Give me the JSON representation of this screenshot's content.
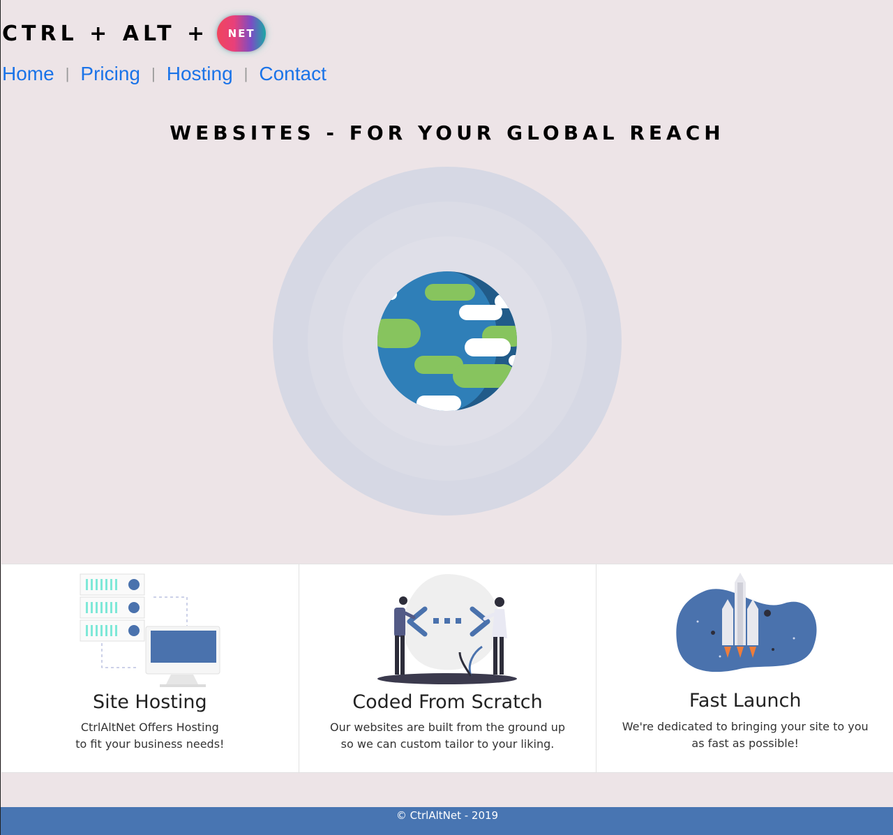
{
  "brand": {
    "text": "CTRL + ALT +",
    "badge": "NET"
  },
  "nav": {
    "items": [
      {
        "label": "Home"
      },
      {
        "label": "Pricing"
      },
      {
        "label": "Hosting"
      },
      {
        "label": "Contact"
      }
    ],
    "separator": "|"
  },
  "hero": {
    "title": "WEBSITES - FOR YOUR GLOBAL REACH",
    "illustration": "globe-icon"
  },
  "features": [
    {
      "icon": "server-monitor-icon",
      "title": "Site Hosting",
      "line1": "CtrlAltNet Offers Hosting",
      "line2": "to fit your business needs!"
    },
    {
      "icon": "code-collaboration-icon",
      "title": "Coded From Scratch",
      "line1": "Our websites are built from the ground up",
      "line2": "so we can custom tailor to your liking."
    },
    {
      "icon": "rocket-icon",
      "title": "Fast Launch",
      "line1": "We're dedicated to bringing your site to you",
      "line2": "as fast as possible!"
    }
  ],
  "footer": {
    "text": "© CtrlAltNet - 2019"
  },
  "colors": {
    "background": "#ede4e7",
    "accent": "#4875b2",
    "link": "#1a73e8"
  }
}
